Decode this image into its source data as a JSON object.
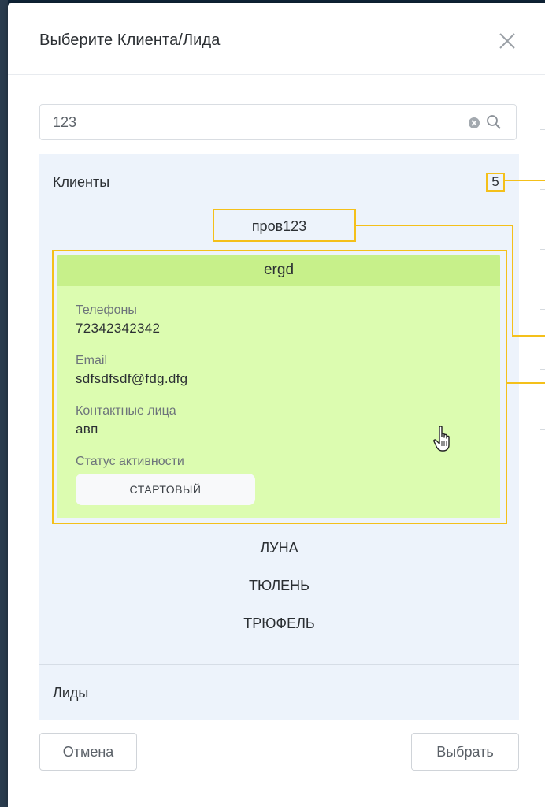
{
  "dialog": {
    "title": "Выберите Клиента/Лида"
  },
  "search": {
    "value": "123",
    "placeholder": ""
  },
  "clients": {
    "label": "Клиенты",
    "count": "5",
    "items": [
      "пров123",
      "ergd",
      "ЛУНА",
      "ТЮЛЕНЬ",
      "ТРЮФЕЛЬ"
    ],
    "selected_card": {
      "name": "ergd",
      "phones_label": "Телефоны",
      "phones_value": "72342342342",
      "email_label": "Email",
      "email_value": "sdfsdfsdf@fdg.dfg",
      "contacts_label": "Контактные лица",
      "contacts_value": "авп",
      "status_label": "Статус активности",
      "status_value": "СТАРТОВЫЙ"
    }
  },
  "leads": {
    "label": "Лиды"
  },
  "footer": {
    "cancel_label": "Отмена",
    "select_label": "Выбрать"
  },
  "colors": {
    "highlight": "#f4c01a",
    "card_bg": "#dcfcb0",
    "card_header_bg": "#c7f08a",
    "panel_bg": "#edf3fb"
  },
  "icons": {
    "close": "close-icon",
    "clear": "clear-icon",
    "search": "search-icon",
    "cursor": "hand-pointer-icon"
  }
}
